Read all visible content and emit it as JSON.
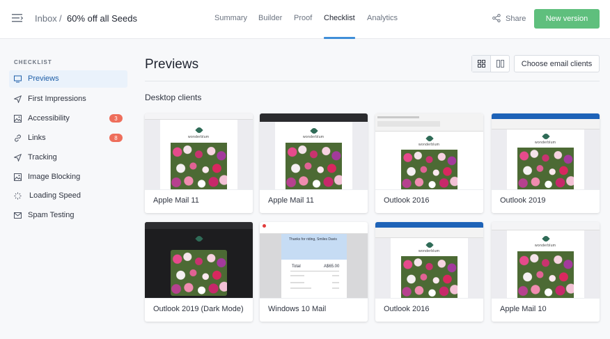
{
  "header": {
    "breadcrumb_root": "Inbox",
    "breadcrumb_sep": "/",
    "campaign_title": "60% off all Seeds",
    "tabs": [
      "Summary",
      "Builder",
      "Proof",
      "Checklist",
      "Analytics"
    ],
    "active_tab": "Checklist",
    "share_label": "Share",
    "new_version_label": "New version"
  },
  "sidebar": {
    "heading": "CHECKLIST",
    "items": [
      {
        "label": "Previews",
        "icon": "monitor-icon",
        "active": true
      },
      {
        "label": "First Impressions",
        "icon": "send-icon"
      },
      {
        "label": "Accessibility",
        "icon": "image-icon",
        "badge": "3"
      },
      {
        "label": "Links",
        "icon": "link-icon",
        "badge": "8"
      },
      {
        "label": "Tracking",
        "icon": "send-icon"
      },
      {
        "label": "Image Blocking",
        "icon": "image-icon"
      },
      {
        "label": "Loading Speed",
        "icon": "spinner-icon"
      },
      {
        "label": "Spam Testing",
        "icon": "mail-icon"
      }
    ]
  },
  "main": {
    "title": "Previews",
    "choose_clients_label": "Choose email clients",
    "section_title": "Desktop clients",
    "cards": [
      {
        "label": "Apple Mail 11"
      },
      {
        "label": "Apple Mail 11"
      },
      {
        "label": "Outlook 2016"
      },
      {
        "label": "Outlook 2019"
      },
      {
        "label": "Outlook 2019 (Dark Mode)"
      },
      {
        "label": "Windows 10 Mail"
      },
      {
        "label": "Outlook 2016"
      },
      {
        "label": "Apple Mail 10"
      }
    ],
    "preview_brand": "wonderblum",
    "receipt": {
      "heading": "Thanks for riding, Smiles Davis",
      "total_label": "Total",
      "total_value": "A$65.00"
    }
  },
  "colors": {
    "accent": "#3f8ed8",
    "primary_button": "#5fbf7d",
    "badge": "#ee6e5b",
    "active_item_bg": "#eaf2fb"
  }
}
